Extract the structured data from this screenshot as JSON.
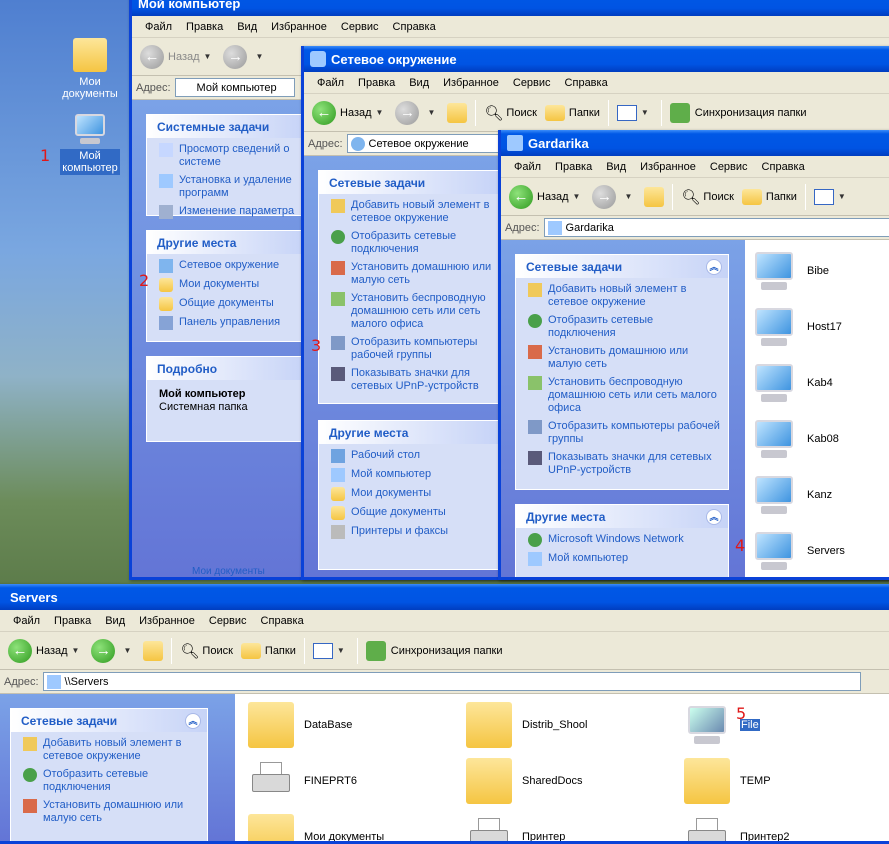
{
  "desktop": {
    "icons": [
      {
        "label_line1": "Мои",
        "label_line2": "документы"
      },
      {
        "label_line1": "Мой",
        "label_line2": "компьютер"
      }
    ],
    "marks": [
      "1",
      "2",
      "3",
      "4",
      "5"
    ]
  },
  "menu": [
    "Файл",
    "Правка",
    "Вид",
    "Избранное",
    "Сервис",
    "Справка"
  ],
  "toolbar": {
    "back": "Назад",
    "search": "Поиск",
    "folders": "Папки",
    "sync": "Синхронизация папки"
  },
  "address_label": "Адрес:",
  "win1": {
    "title": "Мой компьютер",
    "address": "Мой компьютер",
    "system_tasks": {
      "header": "Системные задачи",
      "items": [
        "Просмотр сведений о системе",
        "Установка и удаление программ",
        "Изменение параметра"
      ]
    },
    "other_places": {
      "header": "Другие места",
      "items": [
        "Сетевое окружение",
        "Мои документы",
        "Общие документы",
        "Панель управления"
      ]
    },
    "details": {
      "header": "Подробно",
      "name": "Мой компьютер",
      "type": "Системная папка"
    },
    "partial_text": "Мои документы"
  },
  "win2": {
    "title": "Сетевое окружение",
    "address": "Сетевое окружение",
    "net_tasks": {
      "header": "Сетевые задачи",
      "items": [
        "Добавить новый элемент в сетевое окружение",
        "Отобразить сетевые подключения",
        "Установить домашнюю или малую сеть",
        "Установить беспроводную домашнюю сеть или сеть малого офиса",
        "Отобразить компьютеры рабочей группы",
        "Показывать значки для сетевых UPnP-устройств"
      ]
    },
    "other_places": {
      "header": "Другие места",
      "items": [
        "Рабочий стол",
        "Мой компьютер",
        "Мои документы",
        "Общие документы",
        "Принтеры и факсы"
      ]
    }
  },
  "win3": {
    "title": "Gardarika",
    "address": "Gardarika",
    "net_tasks": {
      "header": "Сетевые задачи",
      "items": [
        "Добавить новый элемент в сетевое окружение",
        "Отобразить сетевые подключения",
        "Установить домашнюю или малую сеть",
        "Установить беспроводную домашнюю сеть или сеть малого офиса",
        "Отобразить компьютеры рабочей группы",
        "Показывать значки для сетевых UPnP-устройств"
      ]
    },
    "other_places": {
      "header": "Другие места",
      "items": [
        "Microsoft Windows Network",
        "Мой компьютер"
      ]
    },
    "computers": [
      "Bibe",
      "Host17",
      "Kab4",
      "Kab08",
      "Kanz",
      "Servers"
    ]
  },
  "win4": {
    "title": "Servers",
    "address": "\\\\Servers",
    "net_tasks": {
      "header": "Сетевые задачи",
      "items": [
        "Добавить новый элемент в сетевое окружение",
        "Отобразить сетевые подключения",
        "Установить домашнюю или малую сеть"
      ]
    },
    "shares": [
      "DataBase",
      "Distrib_Shool",
      "File",
      "FINEPRT6",
      "SharedDocs",
      "TEMP",
      "Мои документы",
      "Принтер",
      "Принтер2"
    ]
  }
}
